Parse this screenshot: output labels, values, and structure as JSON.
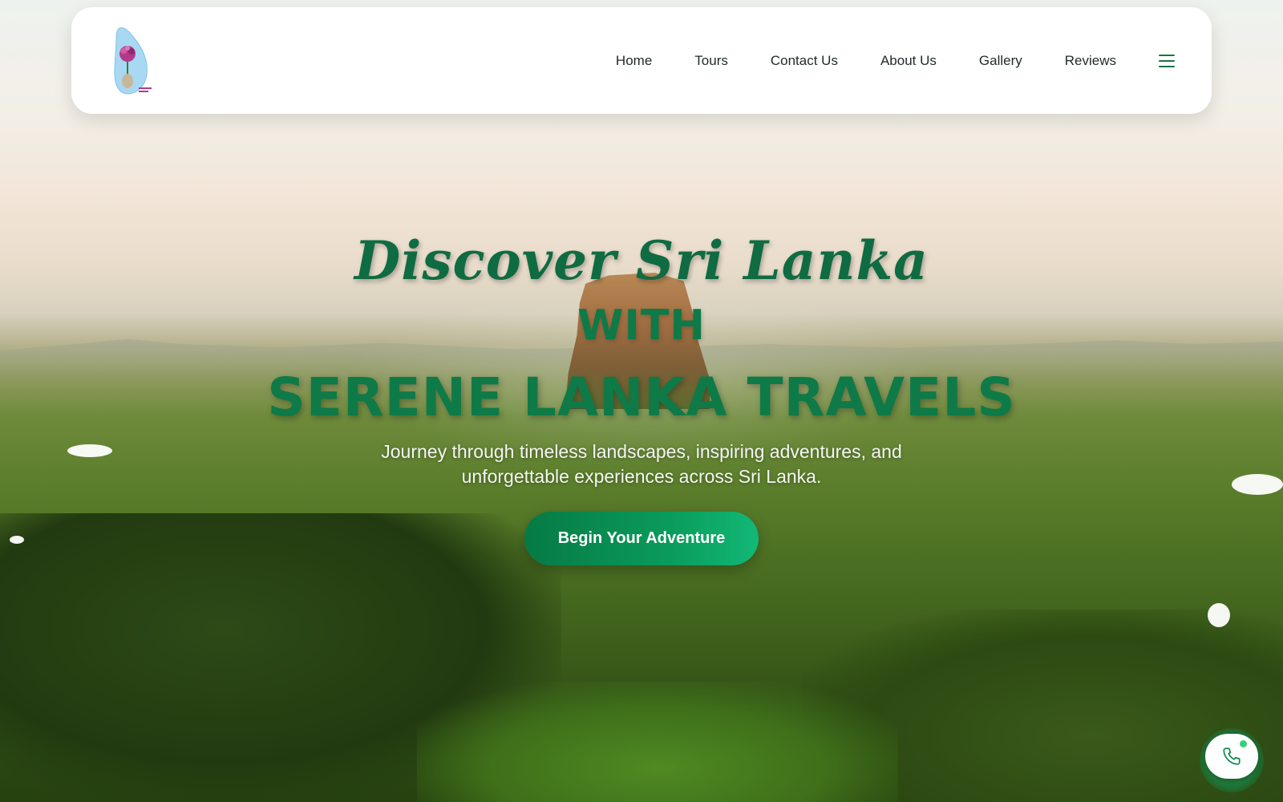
{
  "nav": {
    "logo_icon": "sri-lanka-map-logo",
    "links": [
      {
        "label": "Home"
      },
      {
        "label": "Tours"
      },
      {
        "label": "Contact Us"
      },
      {
        "label": "About Us"
      },
      {
        "label": "Gallery"
      },
      {
        "label": "Reviews"
      }
    ],
    "menu_icon": "hamburger-menu-icon"
  },
  "hero": {
    "script_title": "Discover Sri Lanka",
    "with_word": "WITH",
    "brand": "SERENE LANKA TRAVELS",
    "tagline": "Journey through timeless landscapes, inspiring adventures, and unforgettable experiences across Sri Lanka.",
    "cta_label": "Begin Your Adventure"
  },
  "floating": {
    "call_icon": "phone-icon"
  },
  "colors": {
    "brand_green": "#0e7a47",
    "cta_start": "#067a45",
    "cta_end": "#12b877",
    "nav_text": "#1f2a2a"
  }
}
